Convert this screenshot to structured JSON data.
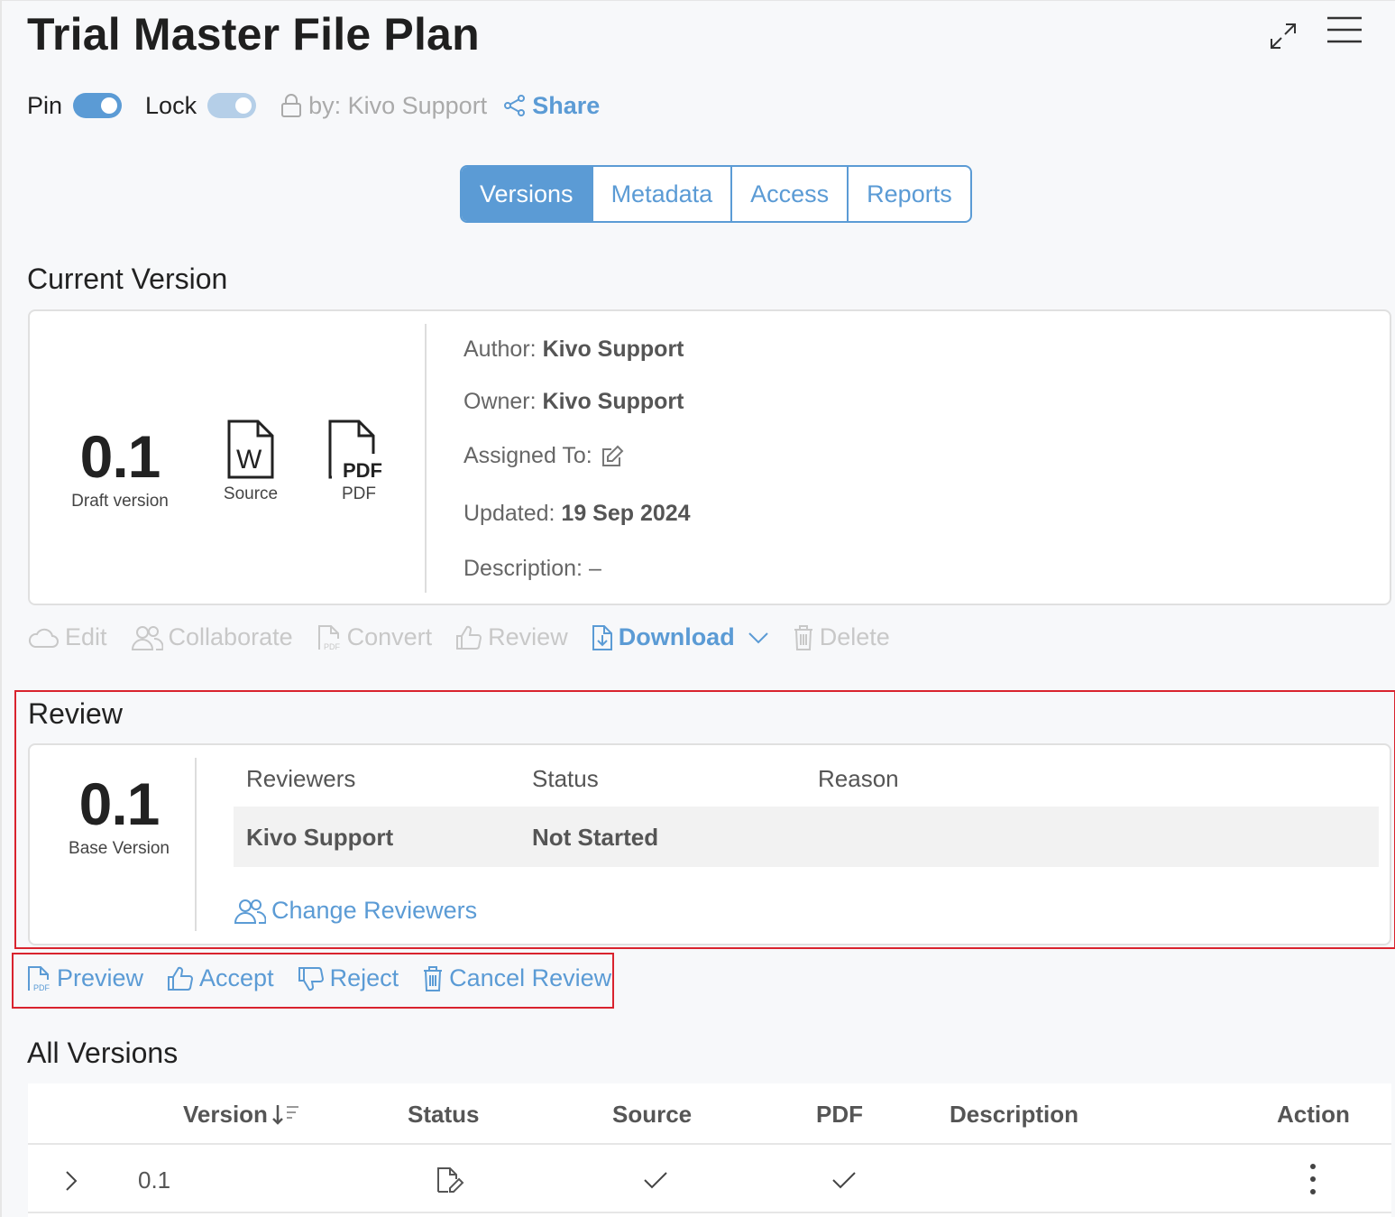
{
  "header": {
    "title": "Trial Master File Plan",
    "pin_label": "Pin",
    "lock_label": "Lock",
    "locked_by": "by: Kivo Support",
    "share_label": "Share"
  },
  "tabs": [
    {
      "label": "Versions",
      "active": true
    },
    {
      "label": "Metadata",
      "active": false
    },
    {
      "label": "Access",
      "active": false
    },
    {
      "label": "Reports",
      "active": false
    }
  ],
  "current_version": {
    "heading": "Current Version",
    "number": "0.1",
    "number_label": "Draft version",
    "source_label": "Source",
    "pdf_label": "PDF",
    "pdf_icon_text": "PDF",
    "word_icon_text": "W",
    "author_label": "Author:",
    "author_value": "Kivo Support",
    "owner_label": "Owner:",
    "owner_value": "Kivo Support",
    "assigned_label": "Assigned To:",
    "updated_label": "Updated:",
    "updated_value": "19 Sep 2024",
    "description_label": "Description: –"
  },
  "version_actions": {
    "edit": "Edit",
    "collaborate": "Collaborate",
    "convert": "Convert",
    "review": "Review",
    "download": "Download",
    "delete": "Delete"
  },
  "review": {
    "heading": "Review",
    "number": "0.1",
    "number_label": "Base Version",
    "col_reviewers": "Reviewers",
    "col_status": "Status",
    "col_reason": "Reason",
    "reviewer_name": "Kivo Support",
    "reviewer_status": "Not Started",
    "reviewer_reason": "",
    "change_reviewers": "Change Reviewers"
  },
  "review_actions": {
    "preview": "Preview",
    "accept": "Accept",
    "reject": "Reject",
    "cancel_review": "Cancel Review"
  },
  "all_versions": {
    "heading": "All Versions",
    "columns": [
      "Version",
      "Status",
      "Source",
      "PDF",
      "Description",
      "Action"
    ],
    "rows": [
      {
        "version": "0.1",
        "status_icon": "draft-edit-icon",
        "source": true,
        "pdf": true,
        "description": ""
      }
    ]
  },
  "colors": {
    "accent": "#5b9bd5",
    "highlight_border": "#d9232e",
    "disabled": "#c8c8c8"
  }
}
